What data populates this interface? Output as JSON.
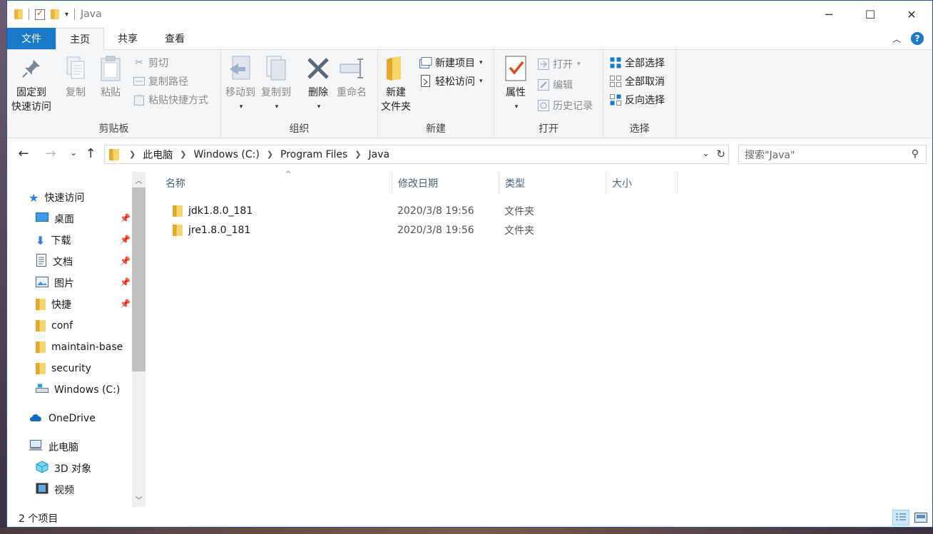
{
  "window": {
    "title": "Java"
  },
  "tabs": [
    {
      "label": "文件"
    },
    {
      "label": "主页"
    },
    {
      "label": "共享"
    },
    {
      "label": "查看"
    }
  ],
  "ribbon": {
    "clipboard": {
      "label": "剪贴板",
      "pin_quick": [
        "固定到",
        "快速访问"
      ],
      "copy": "复制",
      "paste": "粘贴",
      "cut": "剪切",
      "copy_path": "复制路径",
      "paste_shortcut": "粘贴快捷方式"
    },
    "organize": {
      "label": "组织",
      "move_to": "移动到",
      "copy_to": "复制到",
      "delete": "删除",
      "rename": "重命名"
    },
    "new": {
      "label": "新建",
      "new_folder": [
        "新建",
        "文件夹"
      ],
      "new_item": "新建项目",
      "easy_access": "轻松访问"
    },
    "open": {
      "label": "打开",
      "properties": "属性",
      "open": "打开",
      "edit": "编辑",
      "history": "历史记录"
    },
    "select": {
      "label": "选择",
      "select_all": "全部选择",
      "select_none": "全部取消",
      "invert": "反向选择"
    }
  },
  "address": {
    "crumbs": [
      "此电脑",
      "Windows (C:)",
      "Program Files",
      "Java"
    ]
  },
  "search": {
    "placeholder": "搜索\"Java\""
  },
  "nav": {
    "quick_access": "快速访问",
    "items": [
      {
        "label": "桌面",
        "icon": "desktop-icon",
        "pinned": true
      },
      {
        "label": "下载",
        "icon": "download-icon",
        "pinned": true
      },
      {
        "label": "文档",
        "icon": "document-icon",
        "pinned": true
      },
      {
        "label": "图片",
        "icon": "pictures-icon",
        "pinned": true
      },
      {
        "label": "快捷",
        "icon": "folder-icon",
        "pinned": true
      },
      {
        "label": "conf",
        "icon": "folder-icon",
        "pinned": false
      },
      {
        "label": "maintain-base",
        "icon": "folder-icon",
        "pinned": false
      },
      {
        "label": "security",
        "icon": "folder-icon",
        "pinned": false
      },
      {
        "label": "Windows (C:)",
        "icon": "drive-icon",
        "pinned": false
      }
    ],
    "onedrive": "OneDrive",
    "this_pc": "此电脑",
    "pc_items": [
      {
        "label": "3D 对象",
        "icon": "3d-objects-icon"
      },
      {
        "label": "视频",
        "icon": "video-icon"
      }
    ]
  },
  "columns": {
    "name": "名称",
    "modified": "修改日期",
    "type": "类型",
    "size": "大小"
  },
  "files": [
    {
      "name": "jdk1.8.0_181",
      "modified": "2020/3/8 19:56",
      "type": "文件夹"
    },
    {
      "name": "jre1.8.0_181",
      "modified": "2020/3/8 19:56",
      "type": "文件夹"
    }
  ],
  "status": {
    "count": "2 个项目"
  }
}
